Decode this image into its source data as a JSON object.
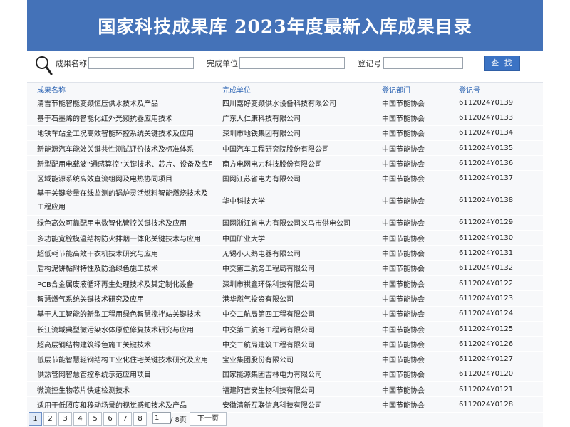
{
  "header": {
    "title": "国家科技成果库 2023年度最新入库成果目录"
  },
  "search": {
    "fields": [
      {
        "label": "成果名称",
        "value": ""
      },
      {
        "label": "完成单位",
        "value": ""
      },
      {
        "label": "登记号",
        "value": ""
      }
    ],
    "button_label": "查 找",
    "icon": "magnifier-icon"
  },
  "table": {
    "columns": [
      "成果名称",
      "完成单位",
      "登记部门",
      "登记号"
    ],
    "rows": [
      [
        "清吉节能智能变频恒压供水技术及产品",
        "四川嘉好变频供水设备科技有限公司",
        "中国节能协会",
        "6112024Y0139"
      ],
      [
        "基于石墨烯的智能化红外光频抗器应用技术",
        "广东人仁康科技有限公司",
        "中国节能协会",
        "6112024Y0133"
      ],
      [
        "地铁车站全工况高效智能环控系统关键技术及应用",
        "深圳市地铁集团有限公司",
        "中国节能协会",
        "6112024Y0134"
      ],
      [
        "新能源汽车能效关键共性测试评价技术及标准体系",
        "中国汽车工程研究院股份有限公司",
        "中国节能协会",
        "6112024Y0135"
      ],
      [
        "新型配用电载波“通感算控”关键技术、芯片、设备及应用",
        "南方电网电力科技股份有限公司",
        "中国节能协会",
        "6112024Y0136"
      ],
      [
        "区域能源系统高效直流组网及电热协同项目",
        "国网江苏省电力有限公司",
        "中国节能协会",
        "6112024Y0137"
      ],
      [
        "基于关键参量在线监测的锅炉灵活燃料智能燃烧技术及工程应用",
        "华中科技大学",
        "中国节能协会",
        "6112024Y0138"
      ],
      [
        "绿色高效可靠配用电数智化管控关键技术及应用",
        "国网浙江省电力有限公司义乌市供电公司",
        "中国节能协会",
        "6112024Y0129"
      ],
      [
        "多功能宽腔模温结构防火排烟一体化关键技术与应用",
        "中国矿业大学",
        "中国节能协会",
        "6112024Y0130"
      ],
      [
        "超低耗节能高效干衣机技术研究与应用",
        "无锡小天鹅电器有限公司",
        "中国节能协会",
        "6112024Y0131"
      ],
      [
        "盾构泥饼黏附特性及防治绿色施工技术",
        "中交第二航务工程局有限公司",
        "中国节能协会",
        "6112024Y0132"
      ],
      [
        "PCB含金属废液循环再生处理技术及其定制化设备",
        "深圳市祺鑫环保科技有限公司",
        "中国节能协会",
        "6112024Y0122"
      ],
      [
        "智慧燃气系统关键技术研究及应用",
        "港华燃气投资有限公司",
        "中国节能协会",
        "6112024Y0123"
      ],
      [
        "基于人工智能的新型工程用绿色智慧搅拌站关键技术",
        "中交二航局第四工程有限公司",
        "中国节能协会",
        "6112024Y0124"
      ],
      [
        "长江流域典型微污染水体原位修复技术研究与应用",
        "中交第二航务工程局有限公司",
        "中国节能协会",
        "6112024Y0125"
      ],
      [
        "超高层钢结构建筑绿色施工关键技术",
        "中交二航局建筑工程有限公司",
        "中国节能协会",
        "6112024Y0126"
      ],
      [
        "低层节能智慧轻钢结构工业化住宅关键技术研究及应用",
        "宝业集团股份有限公司",
        "中国节能协会",
        "6112024Y0127"
      ],
      [
        "供热管网智慧管控系统示范应用项目",
        "国家能源集团吉林电力有限公司",
        "中国节能协会",
        "6112024Y0120"
      ],
      [
        "微流控生物芯片快速检测技术",
        "福建阿吉安生物科技有限公司",
        "中国节能协会",
        "6112024Y0121"
      ],
      [
        "适用于低照度和移动场景的视觉感知技术及产品",
        "安徽清新互联信息科技有限公司",
        "中国节能协会",
        "6112024Y0128"
      ]
    ]
  },
  "pager": {
    "pages": [
      "1",
      "2",
      "3",
      "4",
      "5",
      "6",
      "7",
      "8"
    ],
    "current": "1",
    "page_input": "1",
    "total_text": "/ 8页",
    "next_label": "下一页"
  },
  "colors": {
    "banner": "#4472b8",
    "link": "#2b63b3",
    "button": "#3b73c4"
  }
}
